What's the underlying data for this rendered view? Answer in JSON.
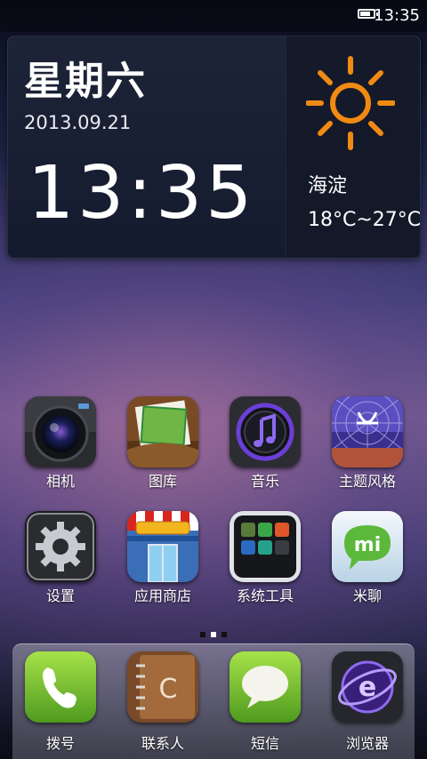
{
  "status_bar": {
    "time": "13:35",
    "battery_icon": "battery-icon",
    "battery_level": 0.8
  },
  "widget": {
    "weekday": "星期六",
    "date": "2013.09.21",
    "time": "13:35",
    "weather_icon": "sun-icon",
    "city": "海淀",
    "temperature": "18°C~27°C"
  },
  "apps": [
    {
      "label": "相机",
      "icon": "camera-icon"
    },
    {
      "label": "图库",
      "icon": "gallery-icon"
    },
    {
      "label": "音乐",
      "icon": "music-icon"
    },
    {
      "label": "主题风格",
      "icon": "theme-icon"
    },
    {
      "label": "设置",
      "icon": "settings-icon"
    },
    {
      "label": "应用商店",
      "icon": "store-icon"
    },
    {
      "label": "系统工具",
      "icon": "tools-folder-icon"
    },
    {
      "label": "米聊",
      "icon": "mitalk-icon"
    }
  ],
  "pager": {
    "pages": 3,
    "active": 2
  },
  "dock": [
    {
      "label": "拨号",
      "icon": "phone-icon"
    },
    {
      "label": "联系人",
      "icon": "contacts-icon"
    },
    {
      "label": "短信",
      "icon": "messages-icon"
    },
    {
      "label": "浏览器",
      "icon": "browser-icon"
    }
  ],
  "colors": {
    "sun": "#f08a12",
    "dock_green": "#7dc33b"
  }
}
